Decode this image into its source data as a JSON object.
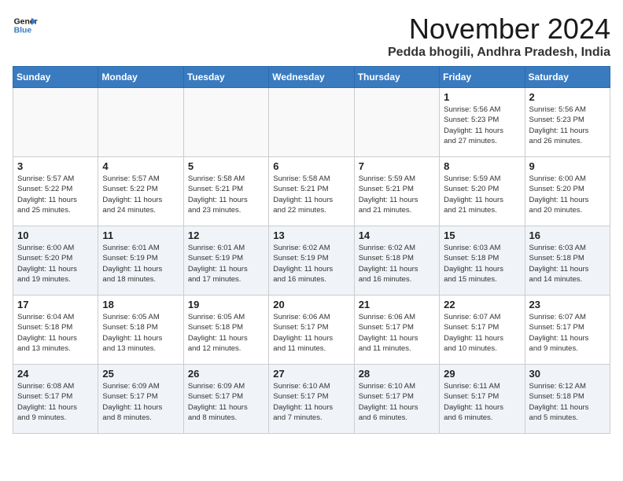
{
  "logo": {
    "line1": "General",
    "line2": "Blue"
  },
  "title": "November 2024",
  "location": "Pedda bhogili, Andhra Pradesh, India",
  "weekdays": [
    "Sunday",
    "Monday",
    "Tuesday",
    "Wednesday",
    "Thursday",
    "Friday",
    "Saturday"
  ],
  "weeks": [
    [
      {
        "day": "",
        "info": ""
      },
      {
        "day": "",
        "info": ""
      },
      {
        "day": "",
        "info": ""
      },
      {
        "day": "",
        "info": ""
      },
      {
        "day": "",
        "info": ""
      },
      {
        "day": "1",
        "info": "Sunrise: 5:56 AM\nSunset: 5:23 PM\nDaylight: 11 hours\nand 27 minutes."
      },
      {
        "day": "2",
        "info": "Sunrise: 5:56 AM\nSunset: 5:23 PM\nDaylight: 11 hours\nand 26 minutes."
      }
    ],
    [
      {
        "day": "3",
        "info": "Sunrise: 5:57 AM\nSunset: 5:22 PM\nDaylight: 11 hours\nand 25 minutes."
      },
      {
        "day": "4",
        "info": "Sunrise: 5:57 AM\nSunset: 5:22 PM\nDaylight: 11 hours\nand 24 minutes."
      },
      {
        "day": "5",
        "info": "Sunrise: 5:58 AM\nSunset: 5:21 PM\nDaylight: 11 hours\nand 23 minutes."
      },
      {
        "day": "6",
        "info": "Sunrise: 5:58 AM\nSunset: 5:21 PM\nDaylight: 11 hours\nand 22 minutes."
      },
      {
        "day": "7",
        "info": "Sunrise: 5:59 AM\nSunset: 5:21 PM\nDaylight: 11 hours\nand 21 minutes."
      },
      {
        "day": "8",
        "info": "Sunrise: 5:59 AM\nSunset: 5:20 PM\nDaylight: 11 hours\nand 21 minutes."
      },
      {
        "day": "9",
        "info": "Sunrise: 6:00 AM\nSunset: 5:20 PM\nDaylight: 11 hours\nand 20 minutes."
      }
    ],
    [
      {
        "day": "10",
        "info": "Sunrise: 6:00 AM\nSunset: 5:20 PM\nDaylight: 11 hours\nand 19 minutes."
      },
      {
        "day": "11",
        "info": "Sunrise: 6:01 AM\nSunset: 5:19 PM\nDaylight: 11 hours\nand 18 minutes."
      },
      {
        "day": "12",
        "info": "Sunrise: 6:01 AM\nSunset: 5:19 PM\nDaylight: 11 hours\nand 17 minutes."
      },
      {
        "day": "13",
        "info": "Sunrise: 6:02 AM\nSunset: 5:19 PM\nDaylight: 11 hours\nand 16 minutes."
      },
      {
        "day": "14",
        "info": "Sunrise: 6:02 AM\nSunset: 5:18 PM\nDaylight: 11 hours\nand 16 minutes."
      },
      {
        "day": "15",
        "info": "Sunrise: 6:03 AM\nSunset: 5:18 PM\nDaylight: 11 hours\nand 15 minutes."
      },
      {
        "day": "16",
        "info": "Sunrise: 6:03 AM\nSunset: 5:18 PM\nDaylight: 11 hours\nand 14 minutes."
      }
    ],
    [
      {
        "day": "17",
        "info": "Sunrise: 6:04 AM\nSunset: 5:18 PM\nDaylight: 11 hours\nand 13 minutes."
      },
      {
        "day": "18",
        "info": "Sunrise: 6:05 AM\nSunset: 5:18 PM\nDaylight: 11 hours\nand 13 minutes."
      },
      {
        "day": "19",
        "info": "Sunrise: 6:05 AM\nSunset: 5:18 PM\nDaylight: 11 hours\nand 12 minutes."
      },
      {
        "day": "20",
        "info": "Sunrise: 6:06 AM\nSunset: 5:17 PM\nDaylight: 11 hours\nand 11 minutes."
      },
      {
        "day": "21",
        "info": "Sunrise: 6:06 AM\nSunset: 5:17 PM\nDaylight: 11 hours\nand 11 minutes."
      },
      {
        "day": "22",
        "info": "Sunrise: 6:07 AM\nSunset: 5:17 PM\nDaylight: 11 hours\nand 10 minutes."
      },
      {
        "day": "23",
        "info": "Sunrise: 6:07 AM\nSunset: 5:17 PM\nDaylight: 11 hours\nand 9 minutes."
      }
    ],
    [
      {
        "day": "24",
        "info": "Sunrise: 6:08 AM\nSunset: 5:17 PM\nDaylight: 11 hours\nand 9 minutes."
      },
      {
        "day": "25",
        "info": "Sunrise: 6:09 AM\nSunset: 5:17 PM\nDaylight: 11 hours\nand 8 minutes."
      },
      {
        "day": "26",
        "info": "Sunrise: 6:09 AM\nSunset: 5:17 PM\nDaylight: 11 hours\nand 8 minutes."
      },
      {
        "day": "27",
        "info": "Sunrise: 6:10 AM\nSunset: 5:17 PM\nDaylight: 11 hours\nand 7 minutes."
      },
      {
        "day": "28",
        "info": "Sunrise: 6:10 AM\nSunset: 5:17 PM\nDaylight: 11 hours\nand 6 minutes."
      },
      {
        "day": "29",
        "info": "Sunrise: 6:11 AM\nSunset: 5:17 PM\nDaylight: 11 hours\nand 6 minutes."
      },
      {
        "day": "30",
        "info": "Sunrise: 6:12 AM\nSunset: 5:18 PM\nDaylight: 11 hours\nand 5 minutes."
      }
    ]
  ]
}
